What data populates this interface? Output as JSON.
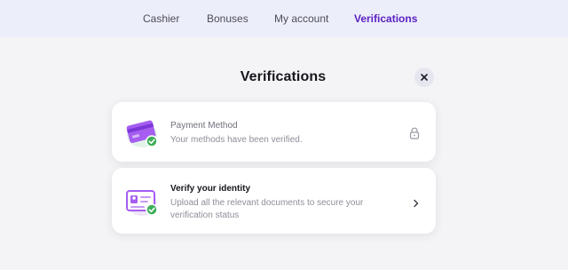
{
  "nav": {
    "tabs": [
      {
        "label": "Cashier"
      },
      {
        "label": "Bonuses"
      },
      {
        "label": "My account"
      },
      {
        "label": "Verifications"
      }
    ],
    "active_tab": "Verifications"
  },
  "page": {
    "title": "Verifications",
    "close_icon": "close-icon"
  },
  "cards": [
    {
      "title": "Payment Method",
      "subtitle": "Your methods have been verified.",
      "icon": "credit-card-icon",
      "status_icon": "check-badge-icon",
      "trailing_icon": "lock-icon"
    },
    {
      "title": "Verify your identity",
      "subtitle": "Upload all the relevant documents to secure your verification status",
      "icon": "id-card-icon",
      "status_icon": "check-badge-icon",
      "trailing_icon": "chevron-right-icon"
    }
  ],
  "colors": {
    "accent": "#5b1fc4",
    "nav_bg": "#eceef9",
    "page_bg": "#f4f4f6",
    "icon_purple": "#a55ef0",
    "check_green": "#3fae5a"
  }
}
